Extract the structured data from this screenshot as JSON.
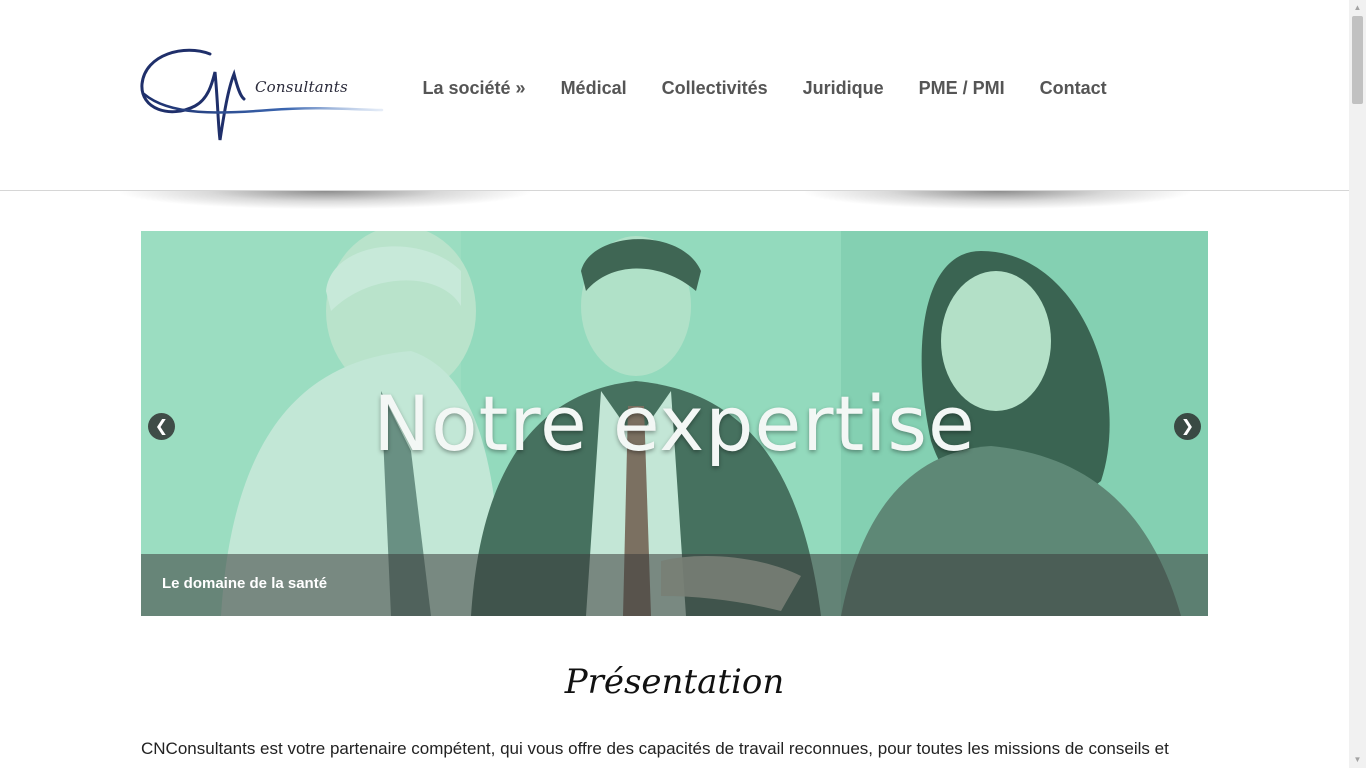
{
  "brand": {
    "logo_text": "Consultants",
    "logo_icon": "cn-signature-logo"
  },
  "nav": {
    "items": [
      {
        "label": "La société »"
      },
      {
        "label": "Médical"
      },
      {
        "label": "Collectivités"
      },
      {
        "label": "Juridique"
      },
      {
        "label": "PME / PMI"
      },
      {
        "label": "Contact"
      }
    ]
  },
  "slider": {
    "title": "Notre expertise",
    "caption": "Le domaine de la santé",
    "prev_icon": "arrow-left-icon",
    "next_icon": "arrow-right-icon"
  },
  "content": {
    "section_title": "Présentation",
    "intro": "CNConsultants est votre partenaire compétent, qui vous offre des capacités de travail reconnues, pour toutes les missions de conseils et"
  },
  "colors": {
    "nav_text": "#555555",
    "logo_blue": "#1f3a7a",
    "slide_tint": "#8fd3b6"
  }
}
